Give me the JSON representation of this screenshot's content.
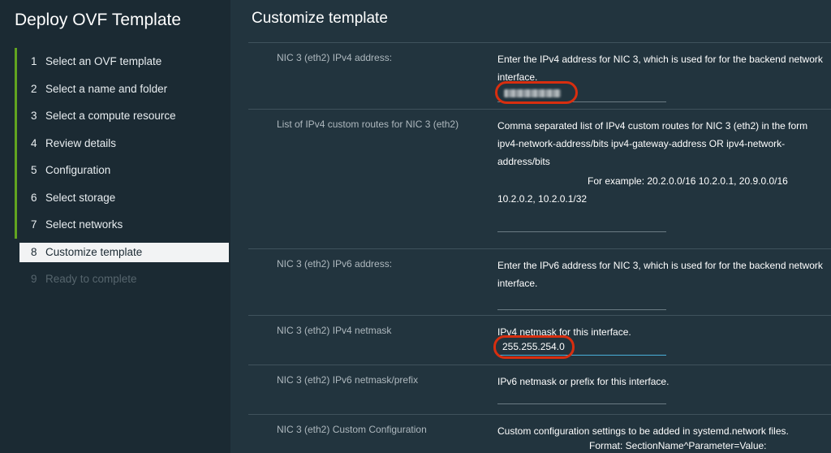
{
  "wizard": {
    "title": "Deploy OVF Template",
    "steps": [
      {
        "num": "1",
        "label": "Select an OVF template"
      },
      {
        "num": "2",
        "label": "Select a name and folder"
      },
      {
        "num": "3",
        "label": "Select a compute resource"
      },
      {
        "num": "4",
        "label": "Review details"
      },
      {
        "num": "5",
        "label": "Configuration"
      },
      {
        "num": "6",
        "label": "Select storage"
      },
      {
        "num": "7",
        "label": "Select networks"
      },
      {
        "num": "8",
        "label": "Customize template"
      },
      {
        "num": "9",
        "label": "Ready to complete"
      }
    ]
  },
  "main": {
    "title": "Customize template",
    "rows": [
      {
        "label": "NIC 3 (eth2) IPv4 address:",
        "description": "Enter the IPv4 address for NIC 3, which is used for for the backend network interface.",
        "value": ""
      },
      {
        "label": "List of IPv4 custom routes for NIC 3 (eth2)",
        "description": "Comma separated list of IPv4 custom routes for NIC 3 (eth2) in the form ipv4-network-address/bits ipv4-gateway-address OR ipv4-network-address/bits",
        "example": "For example: 20.2.0.0/16 10.2.0.1, 20.9.0.0/16 10.2.0.2, 10.2.0.1/32",
        "value": ""
      },
      {
        "label": "NIC 3 (eth2) IPv6 address:",
        "description": "Enter the IPv6 address for NIC 3, which is used for for the backend network interface.",
        "value": ""
      },
      {
        "label": "NIC 3 (eth2) IPv4 netmask",
        "description": "IPv4 netmask for this interface.",
        "value": "255.255.254.0"
      },
      {
        "label": "NIC 3 (eth2) IPv6 netmask/prefix",
        "description": "IPv6 netmask or prefix for this interface.",
        "value": ""
      },
      {
        "label": "NIC 3 (eth2) Custom Configuration",
        "description": "Custom configuration settings to be added in systemd.network files.",
        "format": "Format: SectionName^Parameter=Value:"
      }
    ]
  },
  "colors": {
    "accent_green": "#62a420",
    "highlight_red": "#d82e0f",
    "focus_blue": "#49afd9"
  }
}
